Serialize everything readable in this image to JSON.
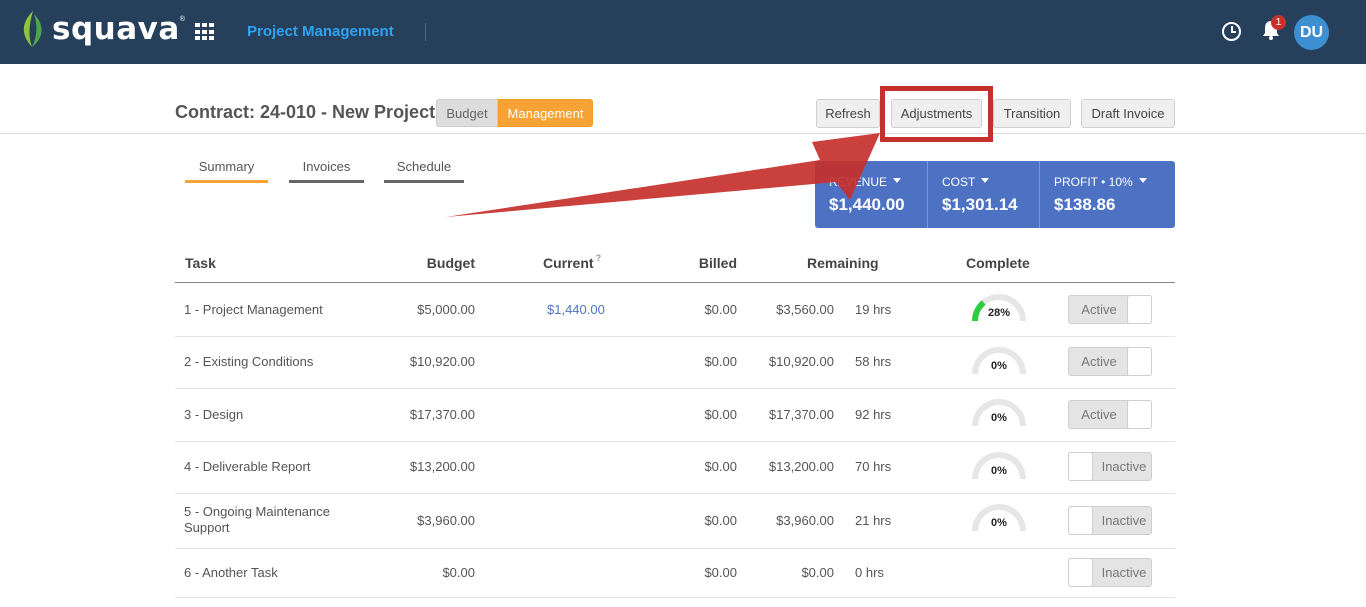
{
  "app": {
    "brand": "squava",
    "brand_mark": "®",
    "module_title": "Project Management",
    "notifications_count": "1",
    "user_initials": "DU"
  },
  "header": {
    "contract_title": "Contract: 24-010 - New Project",
    "view_toggle": {
      "budget_label": "Budget",
      "management_label": "Management",
      "selected": "Management"
    },
    "buttons": {
      "refresh": "Refresh",
      "adjustments": "Adjustments",
      "transition": "Transition",
      "draft_invoice": "Draft Invoice"
    }
  },
  "tabs": [
    {
      "label": "Summary",
      "active": true
    },
    {
      "label": "Invoices",
      "active": false
    },
    {
      "label": "Schedule",
      "active": false
    }
  ],
  "summary": {
    "revenue_label": "REVENUE",
    "revenue_value": "$1,440.00",
    "cost_label": "COST",
    "cost_value": "$1,301.14",
    "profit_label": "PROFIT • 10%",
    "profit_value": "$138.86"
  },
  "table": {
    "headers": {
      "task": "Task",
      "budget": "Budget",
      "current": "Current",
      "current_help": "?",
      "billed": "Billed",
      "remaining": "Remaining",
      "complete": "Complete"
    },
    "rows": [
      {
        "task": "1 - Project Management",
        "budget": "$5,000.00",
        "current": "$1,440.00",
        "billed": "$0.00",
        "remaining": "$3,560.00",
        "hours": "19 hrs",
        "complete": "28%",
        "complete_value": 28,
        "status": "Active"
      },
      {
        "task": "2 - Existing Conditions",
        "budget": "$10,920.00",
        "current": "",
        "billed": "$0.00",
        "remaining": "$10,920.00",
        "hours": "58 hrs",
        "complete": "0%",
        "complete_value": 0,
        "status": "Active"
      },
      {
        "task": "3 - Design",
        "budget": "$17,370.00",
        "current": "",
        "billed": "$0.00",
        "remaining": "$17,370.00",
        "hours": "92 hrs",
        "complete": "0%",
        "complete_value": 0,
        "status": "Active"
      },
      {
        "task": "4 - Deliverable Report",
        "budget": "$13,200.00",
        "current": "",
        "billed": "$0.00",
        "remaining": "$13,200.00",
        "hours": "70 hrs",
        "complete": "0%",
        "complete_value": 0,
        "status": "Inactive"
      },
      {
        "task": "5 - Ongoing Maintenance Support",
        "budget": "$3,960.00",
        "current": "",
        "billed": "$0.00",
        "remaining": "$3,960.00",
        "hours": "21 hrs",
        "complete": "0%",
        "complete_value": 0,
        "status": "Inactive"
      },
      {
        "task": "6 - Another Task",
        "budget": "$0.00",
        "current": "",
        "billed": "$0.00",
        "remaining": "$0.00",
        "hours": "0 hrs",
        "complete": "",
        "complete_value": null,
        "status": "Inactive"
      }
    ]
  },
  "colors": {
    "header_bg": "#26405c",
    "accent_orange": "#f7a234",
    "stats_blue": "#4d72c4",
    "gauge_fill": "#2ecc40",
    "callout_red": "#c4302b"
  },
  "icons": [
    "leaf-logo-icon",
    "apps-grid-icon",
    "clock-icon",
    "bell-icon",
    "caret-down-icon",
    "help-icon",
    "annotation-arrow"
  ]
}
